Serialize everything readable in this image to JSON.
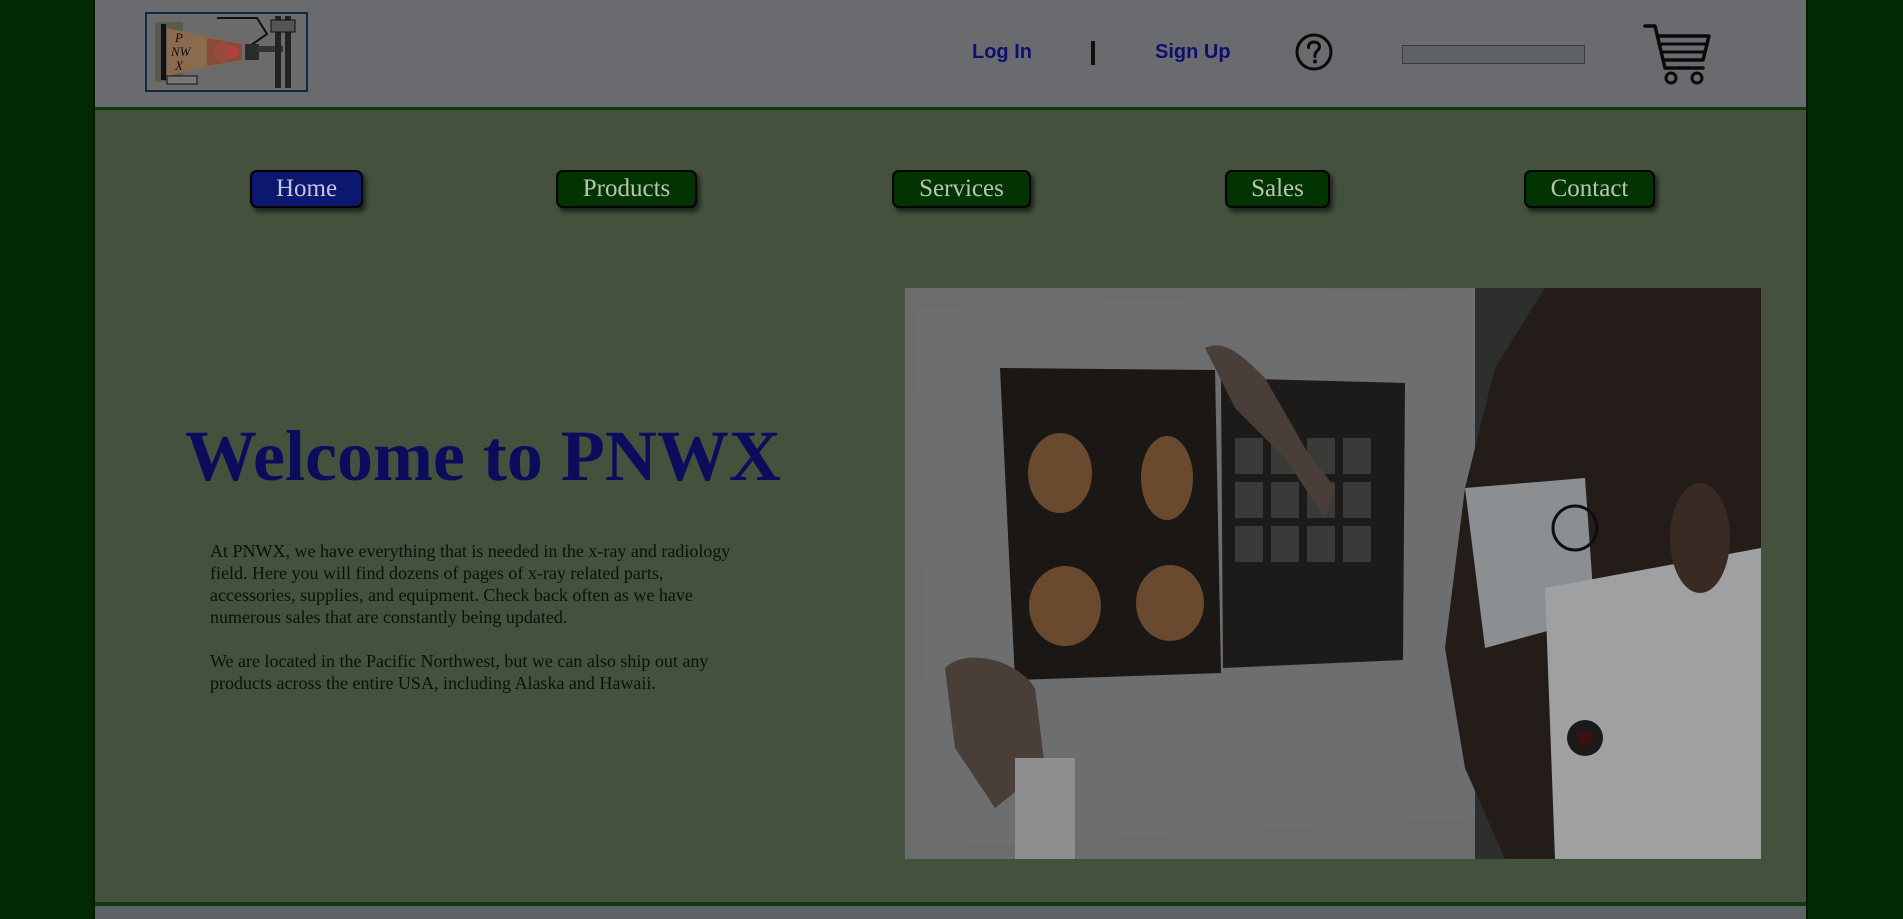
{
  "header": {
    "logo_text": "PNWX",
    "login_label": "Log In",
    "signup_label": "Sign Up",
    "help_icon": "help-circle-icon",
    "search": {
      "value": "",
      "placeholder": ""
    },
    "cart_icon": "shopping-cart-icon"
  },
  "nav": {
    "items": [
      {
        "label": "Home",
        "active": true
      },
      {
        "label": "Products",
        "active": false
      },
      {
        "label": "Services",
        "active": false
      },
      {
        "label": "Sales",
        "active": false
      },
      {
        "label": "Contact",
        "active": false
      }
    ]
  },
  "main": {
    "title": "Welcome to PNWX",
    "paragraphs": [
      "At PNWX, we have everything that is needed in the x-ray and radiology field. Here you will find dozens of pages of x-ray related parts, accessories, supplies, and equipment. Check back often as we have numerous sales that are constantly being updated.",
      "We are located in the Pacific Northwest, but we can also ship out any products across the entire USA, including Alaska and Hawaii."
    ]
  },
  "colors": {
    "page_background": "#022a02",
    "content_background": "#43513d",
    "header_background": "#696b6e",
    "nav_button": "#023402",
    "nav_button_active": "#0c1870",
    "title_text": "#0c0c5c",
    "link_text": "#0d0f6f"
  }
}
